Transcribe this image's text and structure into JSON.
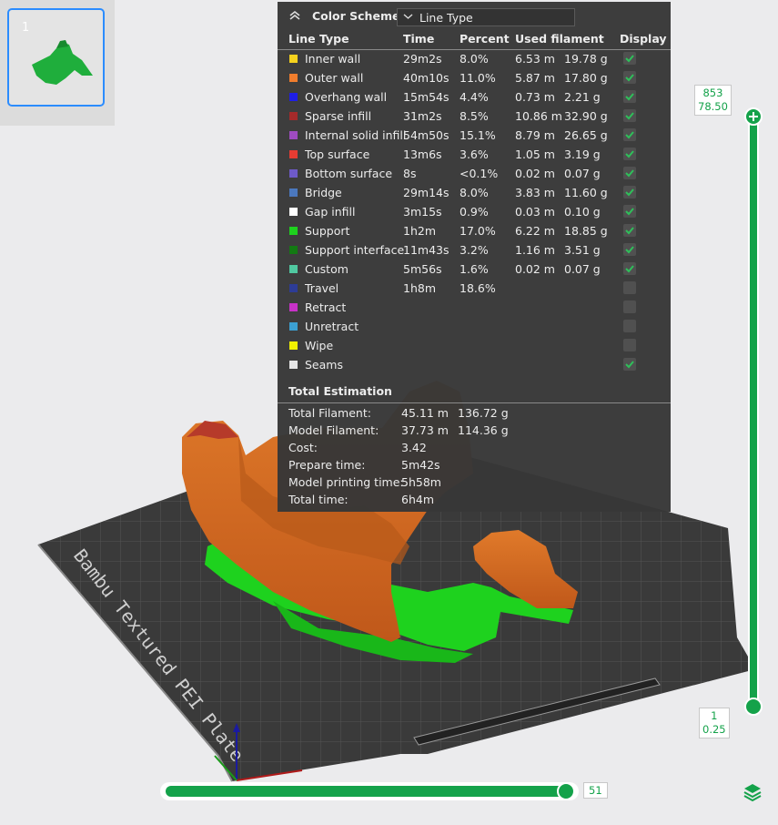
{
  "plate_thumbnails": [
    {
      "number": "1"
    }
  ],
  "legend": {
    "title": "Color Scheme",
    "scheme_select": "Line Type",
    "columns": {
      "line_type": "Line Type",
      "time": "Time",
      "percent": "Percent",
      "used_filament": "Used filament",
      "display": "Display"
    },
    "rows": [
      {
        "name": "Inner wall",
        "color": "#f5d21e",
        "time": "29m2s",
        "percent": "8.0%",
        "length": "6.53 m",
        "weight": "19.78 g",
        "display": true
      },
      {
        "name": "Outer wall",
        "color": "#f07d2d",
        "time": "40m10s",
        "percent": "11.0%",
        "length": "5.87 m",
        "weight": "17.80 g",
        "display": true
      },
      {
        "name": "Overhang wall",
        "color": "#1e1ee6",
        "time": "15m54s",
        "percent": "4.4%",
        "length": "0.73 m",
        "weight": "2.21 g",
        "display": true
      },
      {
        "name": "Sparse infill",
        "color": "#a52a2a",
        "time": "31m2s",
        "percent": "8.5%",
        "length": "10.86 m",
        "weight": "32.90 g",
        "display": true
      },
      {
        "name": "Internal solid infill",
        "color": "#9e4bc0",
        "time": "54m50s",
        "percent": "15.1%",
        "length": "8.79 m",
        "weight": "26.65 g",
        "display": true
      },
      {
        "name": "Top surface",
        "color": "#e63c32",
        "time": "13m6s",
        "percent": "3.6%",
        "length": "1.05 m",
        "weight": "3.19 g",
        "display": true
      },
      {
        "name": "Bottom surface",
        "color": "#6e5ac8",
        "time": "8s",
        "percent": "<0.1%",
        "length": "0.02 m",
        "weight": "0.07 g",
        "display": true
      },
      {
        "name": "Bridge",
        "color": "#4b78be",
        "time": "29m14s",
        "percent": "8.0%",
        "length": "3.83 m",
        "weight": "11.60 g",
        "display": true
      },
      {
        "name": "Gap infill",
        "color": "#ffffff",
        "time": "3m15s",
        "percent": "0.9%",
        "length": "0.03 m",
        "weight": "0.10 g",
        "display": true
      },
      {
        "name": "Support",
        "color": "#1ed21e",
        "time": "1h2m",
        "percent": "17.0%",
        "length": "6.22 m",
        "weight": "18.85 g",
        "display": true
      },
      {
        "name": "Support interface",
        "color": "#137a13",
        "time": "11m43s",
        "percent": "3.2%",
        "length": "1.16 m",
        "weight": "3.51 g",
        "display": true
      },
      {
        "name": "Custom",
        "color": "#50c8a0",
        "time": "5m56s",
        "percent": "1.6%",
        "length": "0.02 m",
        "weight": "0.07 g",
        "display": true
      },
      {
        "name": "Travel",
        "color": "#2d3c96",
        "time": "1h8m",
        "percent": "18.6%",
        "length": "",
        "weight": "",
        "display": false
      },
      {
        "name": "Retract",
        "color": "#c832c8",
        "time": "",
        "percent": "",
        "length": "",
        "weight": "",
        "display": false
      },
      {
        "name": "Unretract",
        "color": "#3ca0d2",
        "time": "",
        "percent": "",
        "length": "",
        "weight": "",
        "display": false
      },
      {
        "name": "Wipe",
        "color": "#f0f000",
        "time": "",
        "percent": "",
        "length": "",
        "weight": "",
        "display": false
      },
      {
        "name": "Seams",
        "color": "#e6e6e6",
        "time": "",
        "percent": "",
        "length": "",
        "weight": "",
        "display": true
      }
    ],
    "total_estimation": {
      "title": "Total Estimation",
      "rows": [
        {
          "label": "Total Filament:",
          "value": "45.11 m",
          "value2": "136.72 g"
        },
        {
          "label": "Model Filament:",
          "value": "37.73 m",
          "value2": "114.36 g"
        },
        {
          "label": "Cost:",
          "value": "3.42",
          "value2": ""
        },
        {
          "label": "Prepare time:",
          "value": "5m42s",
          "value2": ""
        },
        {
          "label": "Model printing time:",
          "value": "5h58m",
          "value2": ""
        },
        {
          "label": "Total time:",
          "value": "6h4m",
          "value2": ""
        }
      ]
    }
  },
  "layer_slider": {
    "top_layer": "853",
    "top_height": "78.50",
    "bottom_layer": "1",
    "bottom_height": "0.25"
  },
  "move_slider": {
    "value": "51"
  },
  "plate_text": "Bambu Textured PEI Plate",
  "colors": {
    "slider_green": "#14a24a",
    "support_green": "#1ed21e",
    "model_orange": "#d2691e",
    "plate_dark": "#3c3c3c"
  }
}
